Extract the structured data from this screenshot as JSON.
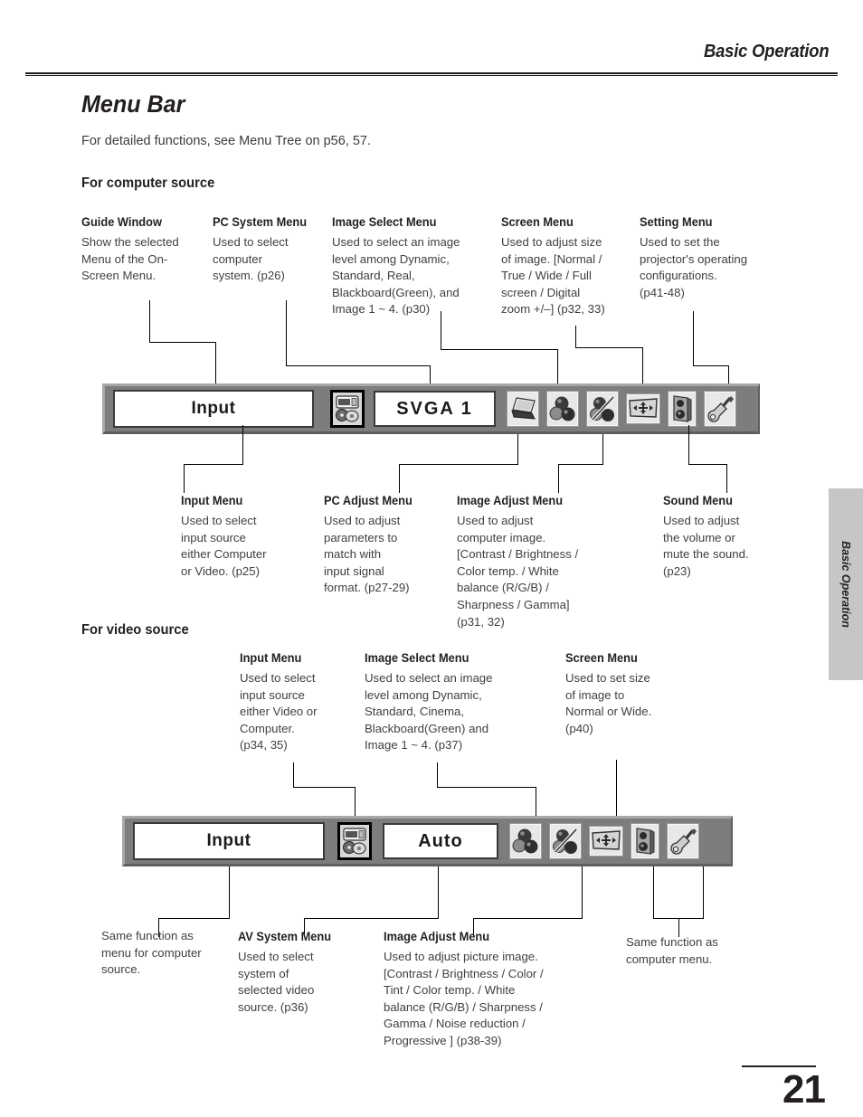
{
  "header": {
    "running_head": "Basic Operation"
  },
  "page": {
    "title": "Menu Bar",
    "intro": "For detailed functions, see Menu Tree on p56, 57.",
    "section_computer": "For computer source",
    "section_video": "For video source",
    "number": "21",
    "side_tab": "Basic Operation"
  },
  "computer": {
    "top_annotations": [
      {
        "title": "Guide Window",
        "body": "Show the selected\nMenu of the On-\nScreen Menu."
      },
      {
        "title": "PC System Menu",
        "body": "Used to select\ncomputer\nsystem.  (p26)"
      },
      {
        "title": "Image Select Menu",
        "body": "Used to select an image\nlevel among Dynamic,\nStandard, Real,\nBlackboard(Green), and\nImage 1 ~ 4.  (p30)"
      },
      {
        "title": "Screen Menu",
        "body": "Used to adjust size\nof image.  [Normal /\nTrue / Wide / Full\nscreen / Digital\nzoom +/–]  (p32, 33)"
      },
      {
        "title": "Setting Menu",
        "body": "Used to set the\nprojector's operating\nconfigurations.\n (p41-48)"
      }
    ],
    "bottom_annotations": [
      {
        "title": "Input Menu",
        "body": "Used to select\ninput source\neither Computer\nor Video.  (p25)"
      },
      {
        "title": "PC Adjust Menu",
        "body": "Used to adjust\nparameters to\nmatch with\ninput signal\nformat.  (p27-29)"
      },
      {
        "title": "Image Adjust Menu",
        "body": "Used to adjust\ncomputer image.\n[Contrast / Brightness /\nColor temp. / White\nbalance (R/G/B) /\nSharpness / Gamma]\n(p31, 32)"
      },
      {
        "title": "Sound Menu",
        "body": "Used to adjust\nthe volume or\nmute the sound.\n(p23)"
      }
    ],
    "menubar": {
      "guide_window_label": "Input",
      "system_label": "SVGA 1",
      "icons": [
        "pc-system-icon",
        "pc-adjust-laptop-icon",
        "image-select-balls-icon",
        "image-adjust-balls-pencil-icon",
        "screen-icon",
        "sound-speaker-icon",
        "setting-tools-icon"
      ]
    }
  },
  "video": {
    "top_annotations": [
      {
        "title": "Input Menu",
        "body": "Used to select\ninput source\neither Video or\nComputer.\n(p34, 35)"
      },
      {
        "title": "Image Select Menu",
        "body": "Used to select an image\nlevel among Dynamic,\nStandard, Cinema,\nBlackboard(Green) and\nImage 1 ~ 4.  (p37)"
      },
      {
        "title": "Screen Menu",
        "body": "Used to set size\nof image to\nNormal or Wide.\n(p40)"
      }
    ],
    "bottom_annotations": [
      {
        "title": "",
        "body": "Same function as\nmenu for computer\nsource."
      },
      {
        "title": "AV System Menu",
        "body": "Used to select\nsystem of\nselected video\nsource.  (p36)"
      },
      {
        "title": "Image Adjust Menu",
        "body": "Used to adjust picture image.\n[Contrast / Brightness / Color /\nTint / Color temp. / White\nbalance (R/G/B) / Sharpness /\nGamma / Noise reduction /\nProgressive ]  (p38-39)"
      },
      {
        "title": "",
        "body": "Same function as\ncomputer menu."
      }
    ],
    "menubar": {
      "guide_window_label": "Input",
      "system_label": "Auto",
      "icons": [
        "av-system-icon",
        "image-select-balls-icon",
        "image-adjust-balls-pencil-icon",
        "screen-icon",
        "sound-speaker-icon",
        "setting-tools-icon"
      ]
    }
  },
  "colors": {
    "menubar_gray": "#7d7d7d",
    "side_tab_gray": "#c6c6c6",
    "ink": "#231f20"
  }
}
